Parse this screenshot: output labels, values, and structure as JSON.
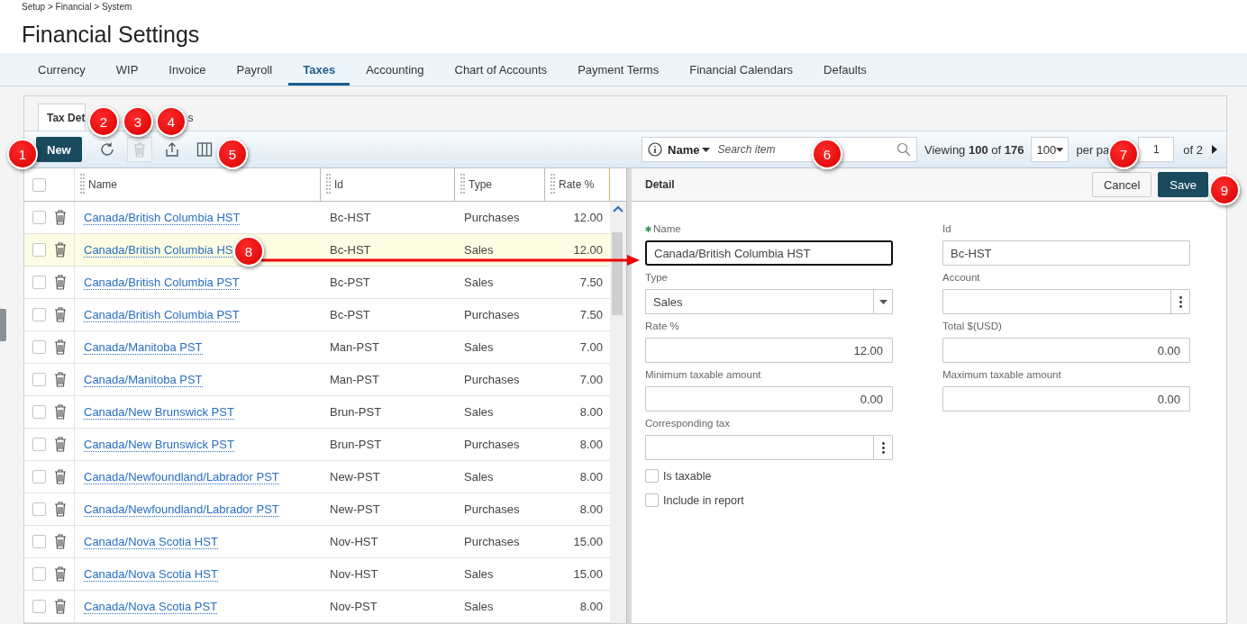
{
  "breadcrumb": "Setup > Financial > System",
  "title": "Financial Settings",
  "nav_tabs": [
    {
      "label": "Currency",
      "selected": false
    },
    {
      "label": "WIP",
      "selected": false
    },
    {
      "label": "Invoice",
      "selected": false
    },
    {
      "label": "Payroll",
      "selected": false
    },
    {
      "label": "Taxes",
      "selected": true
    },
    {
      "label": "Accounting",
      "selected": false
    },
    {
      "label": "Chart of Accounts",
      "selected": false
    },
    {
      "label": "Payment Terms",
      "selected": false
    },
    {
      "label": "Financial Calendars",
      "selected": false
    },
    {
      "label": "Defaults",
      "selected": false
    }
  ],
  "sub_tabs": [
    {
      "label": "Tax Det",
      "selected": true
    },
    {
      "label": "s",
      "selected": false
    }
  ],
  "toolbar": {
    "new_button": "New",
    "search": {
      "field": "Name",
      "placeholder": "Search item"
    },
    "viewing": "Viewing **100** of **176**",
    "page_size": "100",
    "per_page": "per pa",
    "page": "1",
    "of_pages": "of 2"
  },
  "table": {
    "all_selected": false,
    "columns": [
      "Name",
      "Id",
      "Type",
      "Rate %"
    ],
    "rows": [
      {
        "name": "Canada/British Columbia HST",
        "id": "Bc-HST",
        "type": "Purchases",
        "rate": "12.00",
        "selected": false
      },
      {
        "name": "Canada/British Columbia HS",
        "id": "Bc-HST",
        "type": "Sales",
        "rate": "12.00",
        "selected": true
      },
      {
        "name": "Canada/British Columbia PST",
        "id": "Bc-PST",
        "type": "Sales",
        "rate": "7.50",
        "selected": false
      },
      {
        "name": "Canada/British Columbia PST",
        "id": "Bc-PST",
        "type": "Purchases",
        "rate": "7.50",
        "selected": false
      },
      {
        "name": "Canada/Manitoba PST",
        "id": "Man-PST",
        "type": "Sales",
        "rate": "7.00",
        "selected": false
      },
      {
        "name": "Canada/Manitoba PST",
        "id": "Man-PST",
        "type": "Purchases",
        "rate": "7.00",
        "selected": false
      },
      {
        "name": "Canada/New Brunswick PST",
        "id": "Brun-PST",
        "type": "Sales",
        "rate": "8.00",
        "selected": false
      },
      {
        "name": "Canada/New Brunswick PST",
        "id": "Brun-PST",
        "type": "Purchases",
        "rate": "8.00",
        "selected": false
      },
      {
        "name": "Canada/Newfoundland/Labrador PST",
        "id": "New-PST",
        "type": "Sales",
        "rate": "8.00",
        "selected": false
      },
      {
        "name": "Canada/Newfoundland/Labrador PST",
        "id": "New-PST",
        "type": "Purchases",
        "rate": "8.00",
        "selected": false
      },
      {
        "name": "Canada/Nova Scotia HST",
        "id": "Nov-HST",
        "type": "Purchases",
        "rate": "15.00",
        "selected": false
      },
      {
        "name": "Canada/Nova Scotia HST",
        "id": "Nov-HST",
        "type": "Sales",
        "rate": "15.00",
        "selected": false
      },
      {
        "name": "Canada/Nova Scotia PST",
        "id": "Nov-PST",
        "type": "Sales",
        "rate": "8.00",
        "selected": false
      }
    ]
  },
  "detail": {
    "title": "Detail",
    "buttons": [
      {
        "label": "Cancel",
        "kind": "secondary"
      },
      {
        "label": "Save",
        "kind": "primary"
      }
    ],
    "fields": [
      {
        "label": "Name",
        "value": "Canada/British Columbia HST",
        "kind": "text",
        "required": true,
        "focused": true
      },
      {
        "label": "Id",
        "value": "Bc-HST",
        "kind": "text",
        "required": false,
        "focused": false
      },
      {
        "label": "Type",
        "value": "Sales",
        "kind": "select",
        "required": false,
        "focused": false
      },
      {
        "label": "Account",
        "kind": "lookup",
        "required": false,
        "focused": false
      },
      {
        "label": "Rate %",
        "value": "12.00",
        "kind": "number",
        "required": false,
        "focused": false
      },
      {
        "label": "Total $(USD)",
        "value": "0.00",
        "kind": "number",
        "required": false,
        "focused": false
      },
      {
        "label": "Minimum taxable amount",
        "value": "0.00",
        "kind": "number",
        "required": false,
        "focused": false
      },
      {
        "label": "Maximum taxable amount",
        "value": "0.00",
        "kind": "number",
        "required": false,
        "focused": false
      },
      {
        "label": "Corresponding tax",
        "kind": "lookup",
        "required": false,
        "focused": false
      }
    ],
    "checkboxes": [
      {
        "label": "Is taxable",
        "checked": false
      },
      {
        "label": "Include in report",
        "checked": false
      }
    ]
  },
  "callouts": [
    "1",
    "2",
    "3",
    "4",
    "5",
    "6",
    "7",
    "8",
    "9"
  ]
}
